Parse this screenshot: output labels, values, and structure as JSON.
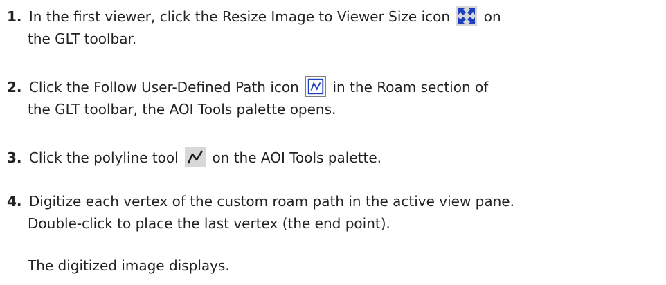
{
  "steps": [
    {
      "number": "1.",
      "line1_before": "In the first viewer, click the Resize Image to Viewer Size icon",
      "line1_after": "on",
      "line2": "the GLT toolbar.",
      "icon": "resize-to-viewer-icon"
    },
    {
      "number": "2.",
      "line1_before": "Click the Follow User-Defined Path icon",
      "line1_after": "in the Roam section of",
      "line2": "the GLT toolbar, the AOI Tools palette opens.",
      "icon": "follow-path-icon"
    },
    {
      "number": "3.",
      "line1_before": "Click the polyline tool",
      "line1_after": "on the AOI Tools palette.",
      "icon": "polyline-tool-icon"
    },
    {
      "number": "4.",
      "line1": "Digitize each vertex of the custom roam path in the active view pane.",
      "line2": "Double-click to place the last vertex (the end point)."
    }
  ],
  "result_note": "The digitized image displays.",
  "colors": {
    "text": "#222222",
    "icon_blue": "#1f3fbf",
    "icon_bg": "#d8d8d8"
  }
}
